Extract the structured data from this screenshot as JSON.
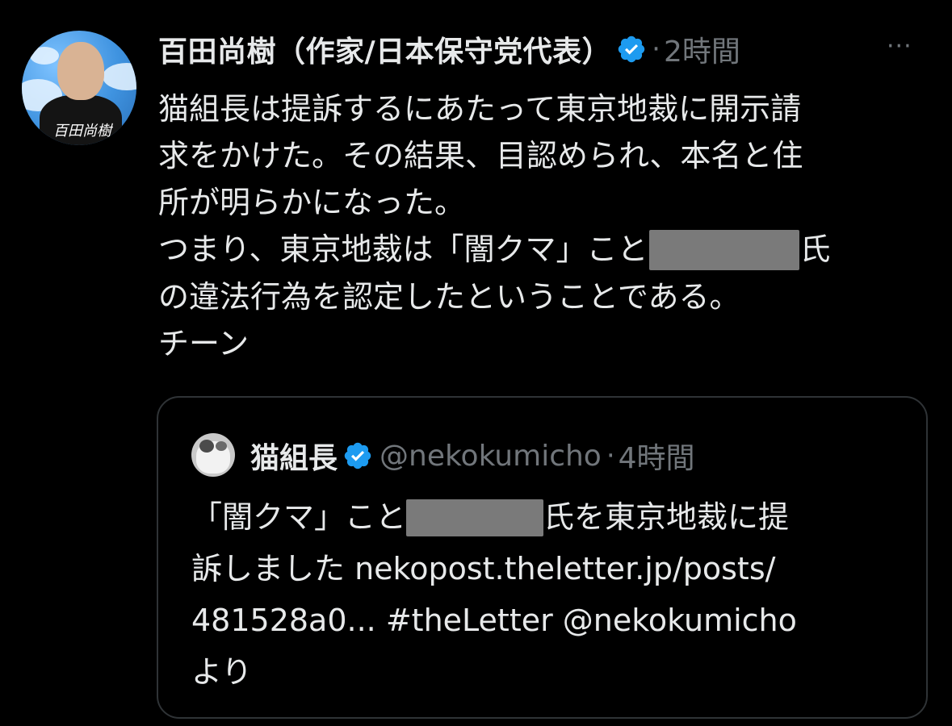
{
  "tweet": {
    "author_name": "百田尚樹（作家/日本保守党代表）",
    "meta_separator": "·",
    "timestamp": "2時間",
    "more_label": "···",
    "avatar_signature": "百田尚樹",
    "body_lines": [
      "猫組長は提訴するにあたって東京地裁に開示請",
      "求をかけた。その結果、目認められ、本名と住",
      "所が明らかになった。",
      "つまり、東京地裁は「闇クマ」こと",
      "氏",
      "の違法行為を認定したということである。",
      "チーン"
    ]
  },
  "quoted": {
    "author_name": "猫組長",
    "handle": "@nekokumicho",
    "meta_separator": "·",
    "timestamp": "4時間",
    "body_lines": [
      "「闇クマ」こと",
      "氏を東京地裁に提",
      "訴しました nekopost.theletter.jp/posts/",
      "481528a0... #theLetter @nekokumicho",
      "より"
    ]
  },
  "colors": {
    "background": "#000000",
    "text_primary": "#e7e9ea",
    "text_secondary": "#71767b",
    "verified_blue": "#1d9bf0",
    "card_border": "#2f3336",
    "redaction": "#7a7a7a"
  },
  "icons": {
    "verified": "verified-badge-icon",
    "more": "more-horizontal-icon"
  }
}
